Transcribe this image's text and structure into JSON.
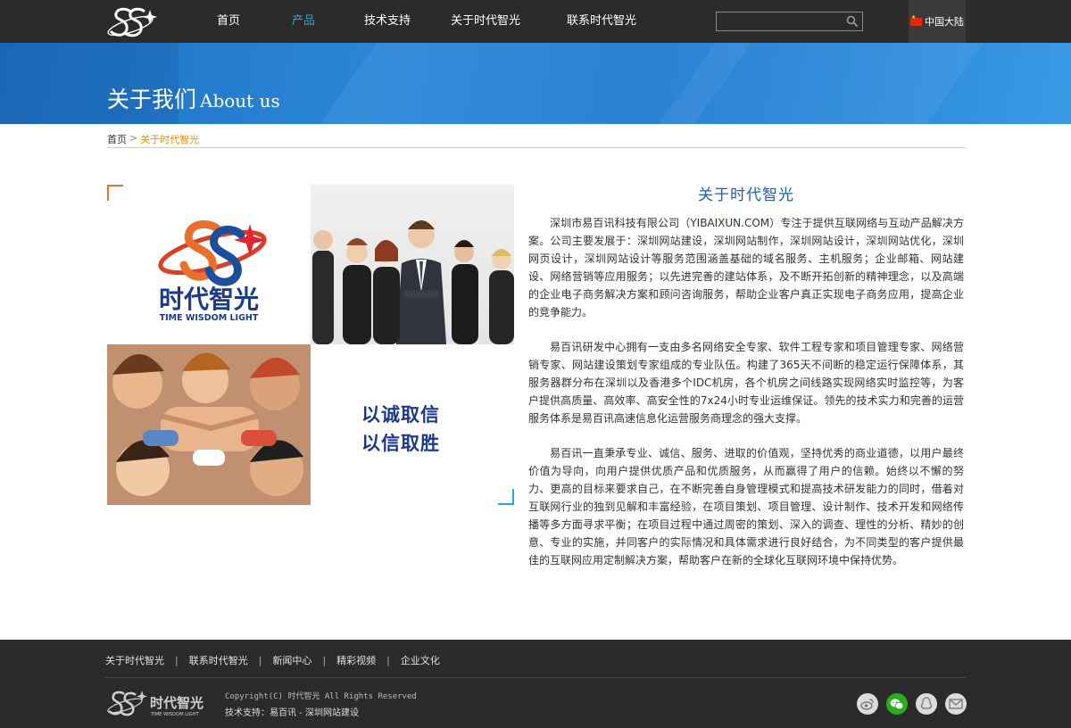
{
  "nav": {
    "items": [
      {
        "label": "首页",
        "active": false
      },
      {
        "label": "产品",
        "active": true
      },
      {
        "label": "技术支持",
        "active": false
      },
      {
        "label": "关于时代智光",
        "active": false
      },
      {
        "label": "联系时代智光",
        "active": false
      }
    ],
    "search_placeholder": "",
    "region_label": "中国大陆"
  },
  "banner": {
    "title_cn": "关于我们",
    "title_en": "About us"
  },
  "breadcrumb": {
    "home": "首页",
    "separator": ">",
    "current": "关于时代智光"
  },
  "collage": {
    "brand_name": "时代智光",
    "brand_name_en": "TIME WISDOM LIGHT",
    "slogan_line1": "以诚取信",
    "slogan_line2": "以信取胜"
  },
  "article": {
    "title": "关于时代智光",
    "paragraphs": [
      "深圳市易百讯科技有限公司（YIBAIXUN.COM）专注于提供互联网络与互动产品解决方案。公司主要发展于：深圳网站建设，深圳网站制作，深圳网站设计，深圳网站优化，深圳网页设计，深圳网站设计等服务范围涵盖基础的域名服务、主机服务；企业邮箱、网站建设、网络营销等应用服务；以先进完善的建站体系，及不断开拓创新的精神理念，以及高端的企业电子商务解决方案和顾问咨询服务，帮助企业客户真正实现电子商务应用，提高企业的竞争能力。",
      "易百讯研发中心拥有一支由多名网络安全专家、软件工程专家和项目管理专家、网络营销专家、网站建设策划专家组成的专业队伍。构建了365天不间断的稳定运行保障体系，其服务器群分布在深圳以及香港多个IDC机房，各个机房之间线路实现网络实时监控等，为客户提供高质量、高效率、高安全性的7x24小时专业运维保证。领先的技术实力和完善的运营服务体系是易百讯高速信息化运营服务商理念的强大支撑。",
      "易百讯一直秉承专业、诚信、服务、进取的价值观，坚持优秀的商业道德，以用户最终价值为导向，向用户提供优质产品和优质服务，从而赢得了用户的信赖。始终以不懈的努力、更高的目标来要求自己，在不断完善自身管理模式和提高技术研发能力的同时，借着对互联网行业的独到见解和丰富经验，在项目策划、项目管理、设计制作、技术开发和网络传播等多方面寻求平衡；在项目过程中通过周密的策划、深入的调查、理性的分析、精妙的创意、专业的实施，并同客户的实际情况和具体需求进行良好结合，为不同类型的客户提供最佳的互联网应用定制解决方案，帮助客户在新的全球化互联网环境中保持优势。"
    ]
  },
  "footer": {
    "links": [
      "关于时代智光",
      "联系时代智光",
      "新闻中心",
      "精彩视频",
      "企业文化"
    ],
    "separator": "|",
    "logo_text": "时代智光",
    "logo_text_en": "TIME WISDOM LIGHT",
    "copyright": "Copyright(C) 时代智光 All Rights Reserved",
    "tech_support": "技术支持：易百讯 - 深圳网站建设",
    "socials": [
      "weibo-icon",
      "wechat-icon",
      "qq-icon",
      "email-icon"
    ]
  },
  "colors": {
    "nav_bg": "#2b2b2b",
    "accent_blue": "#26a6e6",
    "accent_orange": "#f08c00",
    "title_blue": "#1e5fb5",
    "slogan_navy": "#1b3a8c"
  }
}
